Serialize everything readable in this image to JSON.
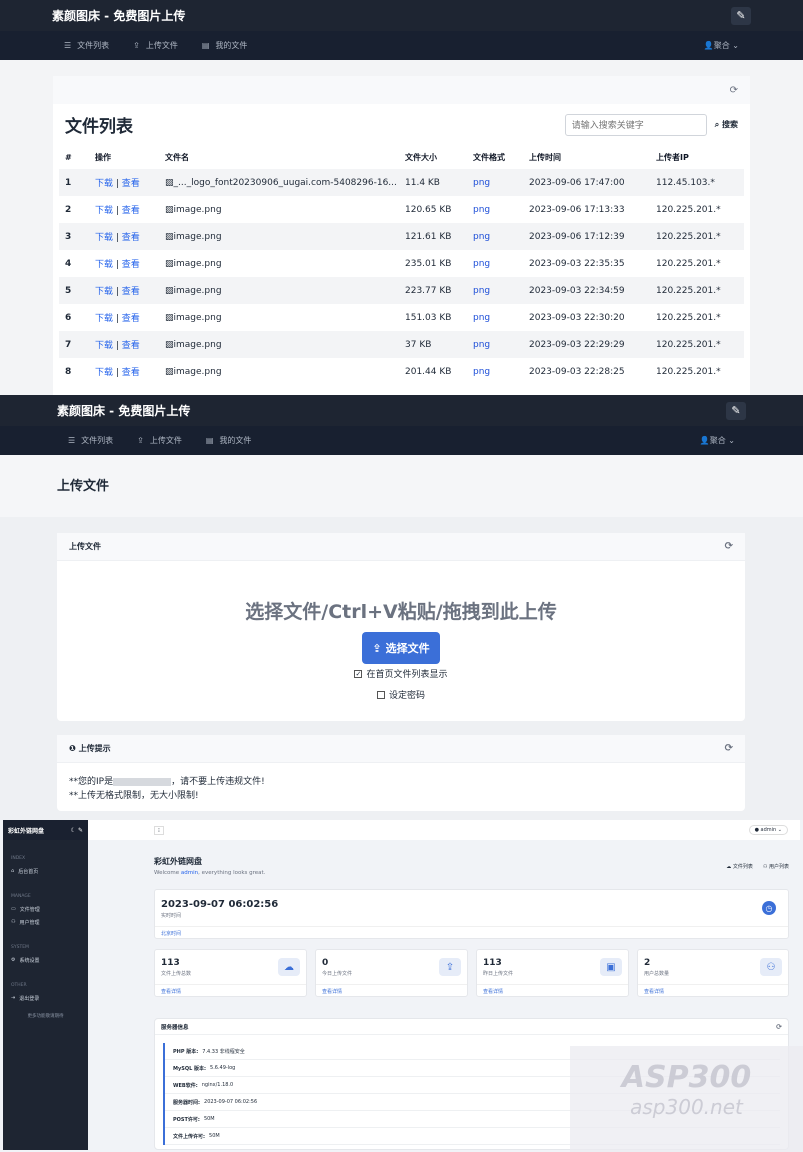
{
  "brand": "素颜图床 - 免费图片上传",
  "nav": {
    "file_list": "文件列表",
    "upload": "上传文件",
    "my_files": "我的文件",
    "user": "聚合"
  },
  "list_page": {
    "title": "文件列表",
    "search_placeholder": "请输入搜索关键字",
    "search_button": "搜索",
    "columns": [
      "#",
      "操作",
      "文件名",
      "文件大小",
      "文件格式",
      "上传时间",
      "上传者IP"
    ],
    "action_download": "下载",
    "action_view": "查看",
    "rows": [
      {
        "n": "1",
        "name": "_..._logo_font20230906_uugai.com-5408296-16...",
        "size": "11.4 KB",
        "fmt": "png",
        "time": "2023-09-06 17:47:00",
        "ip": "112.45.103.*"
      },
      {
        "n": "2",
        "name": "image.png",
        "size": "120.65 KB",
        "fmt": "png",
        "time": "2023-09-06 17:13:33",
        "ip": "120.225.201.*"
      },
      {
        "n": "3",
        "name": "image.png",
        "size": "121.61 KB",
        "fmt": "png",
        "time": "2023-09-06 17:12:39",
        "ip": "120.225.201.*"
      },
      {
        "n": "4",
        "name": "image.png",
        "size": "235.01 KB",
        "fmt": "png",
        "time": "2023-09-03 22:35:35",
        "ip": "120.225.201.*"
      },
      {
        "n": "5",
        "name": "image.png",
        "size": "223.77 KB",
        "fmt": "png",
        "time": "2023-09-03 22:34:59",
        "ip": "120.225.201.*"
      },
      {
        "n": "6",
        "name": "image.png",
        "size": "151.03 KB",
        "fmt": "png",
        "time": "2023-09-03 22:30:20",
        "ip": "120.225.201.*"
      },
      {
        "n": "7",
        "name": "image.png",
        "size": "37 KB",
        "fmt": "png",
        "time": "2023-09-03 22:29:29",
        "ip": "120.225.201.*"
      },
      {
        "n": "8",
        "name": "image.png",
        "size": "201.44 KB",
        "fmt": "png",
        "time": "2023-09-03 22:28:25",
        "ip": "120.225.201.*"
      }
    ]
  },
  "upload_page": {
    "title": "上传文件",
    "card_title": "上传文件",
    "drop_text": "选择文件/Ctrl+V粘贴/拖拽到此上传",
    "select_button": "选择文件",
    "show_on_home": "在首页文件列表显示",
    "set_password": "设定密码",
    "tips_title": "上传提示",
    "tip1_prefix": "**您的IP是",
    "tip1_suffix": "，请不要上传违规文件!",
    "tip2": "**上传无格式限制，无大小限制!"
  },
  "admin": {
    "brand": "彩虹外链网盘",
    "sidebar": {
      "sec_index": "INDEX",
      "home": "后台首页",
      "sec_manage": "MANAGE",
      "file_mgmt": "文件管理",
      "user_mgmt": "用户管理",
      "sec_system": "SYSTEM",
      "settings": "系统设置",
      "sec_other": "OTHER",
      "logout": "退出登录",
      "more": "更多功能敬请期待"
    },
    "user": "admin",
    "title": "彩虹外链网盘",
    "welcome_prefix": "Welcome ",
    "welcome_user": "admin",
    "welcome_suffix": ", everything looks great.",
    "top_links": {
      "files": "文件列表",
      "users": "用户列表"
    },
    "clock": {
      "value": "2023-09-07 06:02:56",
      "label": "实时时间",
      "foot": "北京时间"
    },
    "stats": [
      {
        "num": "113",
        "label": "文件上传总数",
        "foot": "查看详情"
      },
      {
        "num": "0",
        "label": "今日上传文件",
        "foot": "查看详情"
      },
      {
        "num": "113",
        "label": "昨日上传文件",
        "foot": "查看详情"
      },
      {
        "num": "2",
        "label": "用户总数量",
        "foot": "查看详情"
      }
    ],
    "server": {
      "title": "服务器信息",
      "rows": [
        {
          "k": "PHP 版本:",
          "v": "7.4.33 非线程安全"
        },
        {
          "k": "MySQL 版本:",
          "v": "5.6.49-log"
        },
        {
          "k": "WEB软件:",
          "v": "nginx/1.18.0"
        },
        {
          "k": "服务器时间:",
          "v": "2023-09-07 06:02:56"
        },
        {
          "k": "POST许可:",
          "v": "50M"
        },
        {
          "k": "文件上传许可:",
          "v": "50M"
        }
      ]
    }
  },
  "watermark": {
    "big": "ASP300",
    "small": "asp300.net"
  }
}
